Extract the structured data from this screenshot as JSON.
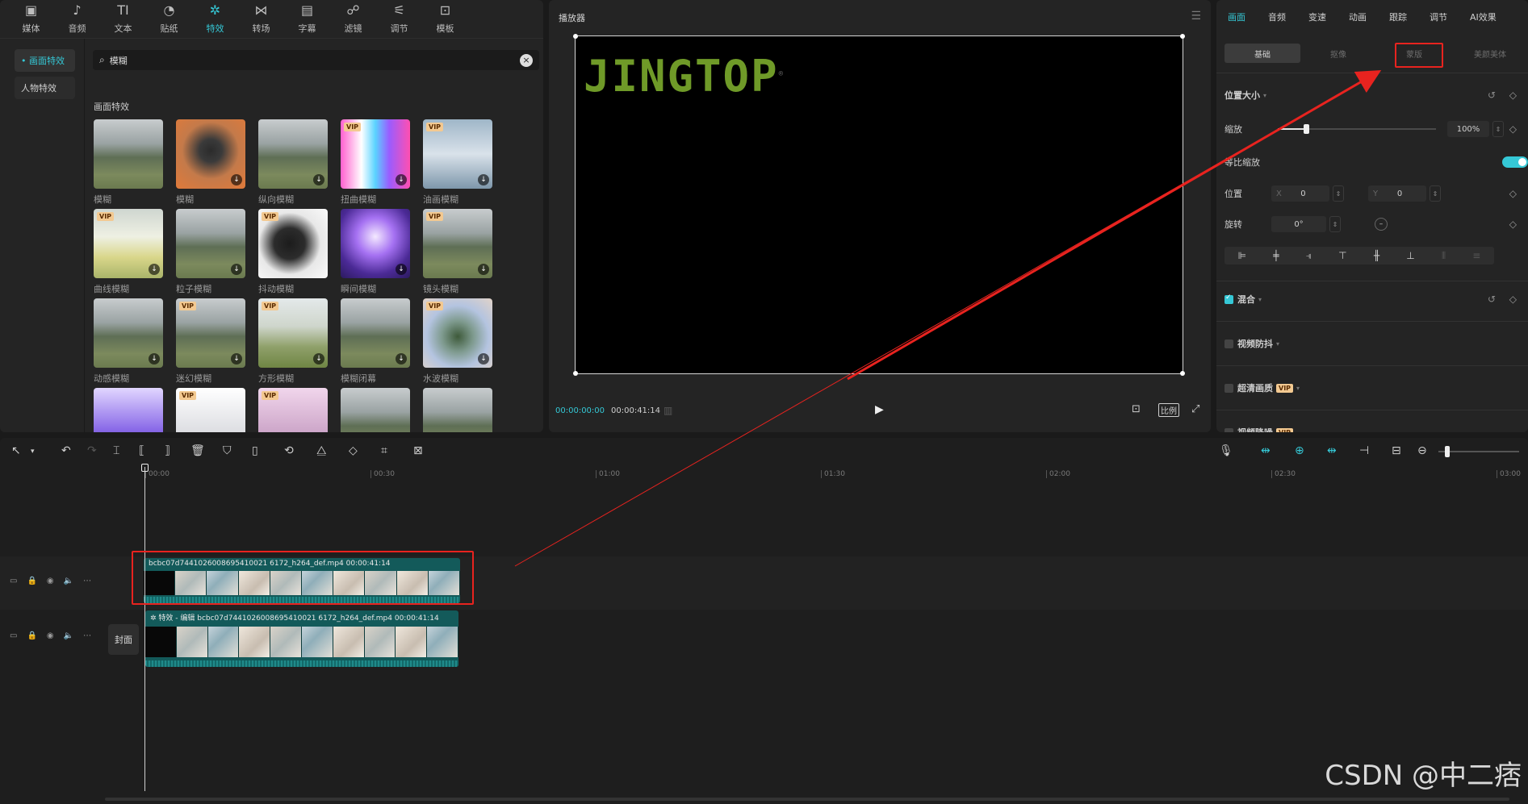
{
  "top_tabs": [
    {
      "label": "媒体",
      "icon": "media-icon",
      "glyph": "▣"
    },
    {
      "label": "音频",
      "icon": "audio-icon",
      "glyph": "♪"
    },
    {
      "label": "文本",
      "icon": "text-icon",
      "glyph": "TI"
    },
    {
      "label": "贴纸",
      "icon": "sticker-icon",
      "glyph": "◔"
    },
    {
      "label": "特效",
      "icon": "effects-icon",
      "glyph": "✲"
    },
    {
      "label": "转场",
      "icon": "transition-icon",
      "glyph": "⋈"
    },
    {
      "label": "字幕",
      "icon": "subtitle-icon",
      "glyph": "▤"
    },
    {
      "label": "滤镜",
      "icon": "filter-icon",
      "glyph": "☍"
    },
    {
      "label": "调节",
      "icon": "adjust-icon",
      "glyph": "⚟"
    },
    {
      "label": "模板",
      "icon": "template-icon",
      "glyph": "⊡"
    }
  ],
  "side_nav": {
    "items": [
      "• 画面特效",
      "人物特效"
    ]
  },
  "search": {
    "value": "模糊"
  },
  "effects": {
    "section_label": "画面特效",
    "items": [
      {
        "label": "模糊",
        "vip": false,
        "download": false,
        "style": "t-forest"
      },
      {
        "label": "模糊",
        "vip": false,
        "download": true,
        "style": "t-person"
      },
      {
        "label": "纵向模糊",
        "vip": false,
        "download": true,
        "style": "t-forest"
      },
      {
        "label": "扭曲模糊",
        "vip": true,
        "download": true,
        "style": "t-glitch"
      },
      {
        "label": "油画模糊",
        "vip": true,
        "download": true,
        "style": "t-oil"
      },
      {
        "label": "曲线模糊",
        "vip": true,
        "download": true,
        "style": "t-bright"
      },
      {
        "label": "粒子模糊",
        "vip": false,
        "download": true,
        "style": "t-forest"
      },
      {
        "label": "抖动模糊",
        "vip": true,
        "download": false,
        "style": "t-bw"
      },
      {
        "label": "瞬间模糊",
        "vip": false,
        "download": true,
        "style": "t-purple"
      },
      {
        "label": "镜头模糊",
        "vip": true,
        "download": true,
        "style": "t-forest"
      },
      {
        "label": "动感模糊",
        "vip": false,
        "download": true,
        "style": "t-forest"
      },
      {
        "label": "迷幻模糊",
        "vip": true,
        "download": true,
        "style": "t-forest"
      },
      {
        "label": "方形模糊",
        "vip": true,
        "download": true,
        "style": "t-field"
      },
      {
        "label": "模糊闭幕",
        "vip": false,
        "download": true,
        "style": "t-forest"
      },
      {
        "label": "水波模糊",
        "vip": true,
        "download": true,
        "style": "t-wave"
      },
      {
        "label": "",
        "vip": false,
        "download": false,
        "style": "t-violet"
      },
      {
        "label": "",
        "vip": true,
        "download": false,
        "style": "t-white"
      },
      {
        "label": "",
        "vip": true,
        "download": false,
        "style": "t-pink"
      },
      {
        "label": "",
        "vip": false,
        "download": false,
        "style": "t-forest"
      },
      {
        "label": "",
        "vip": false,
        "download": false,
        "style": "t-forest"
      }
    ]
  },
  "vip_label": "VIP",
  "player": {
    "title": "播放器",
    "logo_text": "JINGTOP",
    "logo_mark": "®",
    "current_time": "00:00:00:00",
    "total_time": "00:00:41:14",
    "ratio_label": "比例"
  },
  "props": {
    "tabs": [
      "画面",
      "音频",
      "变速",
      "动画",
      "跟踪",
      "调节",
      "AI效果"
    ],
    "subtabs": [
      "基础",
      "抠像",
      "蒙版",
      "美颜美体"
    ],
    "position_size": "位置大小",
    "scale_label": "缩放",
    "scale_value": "100%",
    "scale_fraction": 0.18,
    "uniform_scale": "等比缩放",
    "position_label": "位置",
    "pos_x_label": "X",
    "pos_x": "0",
    "pos_y_label": "Y",
    "pos_y": "0",
    "rotation_label": "旋转",
    "rotation_value": "0°",
    "blend": "混合",
    "stabilize": "视频防抖",
    "hd": "超清画质",
    "denoise": "视频降噪"
  },
  "timeline": {
    "ruler": [
      {
        "label": "00:00"
      },
      {
        "label": "00:30"
      },
      {
        "label": "01:00"
      },
      {
        "label": "01:30"
      },
      {
        "label": "02:00"
      },
      {
        "label": "02:30"
      },
      {
        "label": "03:00"
      }
    ],
    "clip1_title": "bcbc07d7441026008695410021 6172_h264_def.mp4   00:00:41:14",
    "clip2_title": "✲ 特效 - 编辑  bcbc07d7441026008695410021 6172_h264_def.mp4   00:00:41:14",
    "cover_label": "封面"
  },
  "watermark": "CSDN @中二痞",
  "colors": {
    "accent": "#35c8d6",
    "highlight": "#e8231f",
    "clip": "#135a5a",
    "logo": "#6f9a28"
  }
}
